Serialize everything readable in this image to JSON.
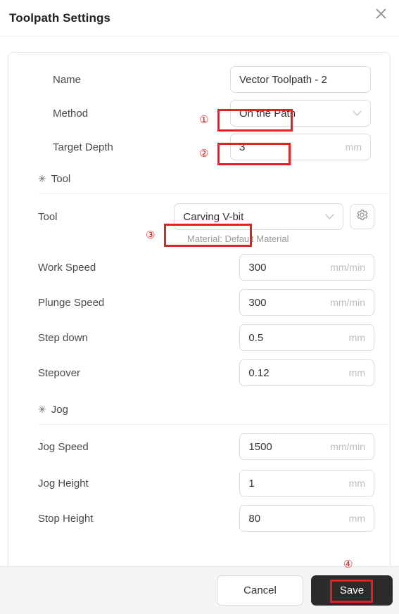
{
  "dialog": {
    "title": "Toolpath Settings",
    "close_icon": "close-icon"
  },
  "form": {
    "name": {
      "label": "Name",
      "value": "Vector Toolpath - 2",
      "placeholder": "Vector Toolpath - 2"
    },
    "method": {
      "label": "Method",
      "value": "On the Path",
      "options": [
        "On the Path"
      ],
      "caret_icon": "chevron-down-icon"
    },
    "target_depth": {
      "label": "Target Depth",
      "value": "3",
      "unit": "mm"
    }
  },
  "tool_section": {
    "icon": "gear-icon",
    "title": "Tool",
    "tool": {
      "label": "Tool",
      "value": "Carving V-bit",
      "options": [
        "Carving V-bit"
      ],
      "caret_icon": "chevron-down-icon",
      "settings_icon": "gear-icon"
    },
    "material_note": "Material: Default Material",
    "fields": [
      {
        "label": "Work Speed",
        "value": "300",
        "unit": "mm/min"
      },
      {
        "label": "Plunge Speed",
        "value": "300",
        "unit": "mm/min"
      },
      {
        "label": "Step down",
        "value": "0.5",
        "unit": "mm"
      },
      {
        "label": "Stepover",
        "value": "0.12",
        "unit": "mm"
      }
    ]
  },
  "jog_section": {
    "icon": "gear-icon",
    "title": "Jog",
    "fields": [
      {
        "label": "Jog Speed",
        "value": "1500",
        "unit": "mm/min"
      },
      {
        "label": "Jog Height",
        "value": "1",
        "unit": "mm"
      },
      {
        "label": "Stop Height",
        "value": "80",
        "unit": "mm"
      }
    ]
  },
  "footer": {
    "cancel_label": "Cancel",
    "save_label": "Save"
  },
  "annotations": {
    "color": "#e81f20",
    "markers": [
      {
        "id": "1",
        "glyph": "①",
        "target": "method-select"
      },
      {
        "id": "2",
        "glyph": "②",
        "target": "target-depth-input"
      },
      {
        "id": "3",
        "glyph": "③",
        "target": "tool-select"
      },
      {
        "id": "4",
        "glyph": "④",
        "target": "save-button"
      }
    ]
  }
}
